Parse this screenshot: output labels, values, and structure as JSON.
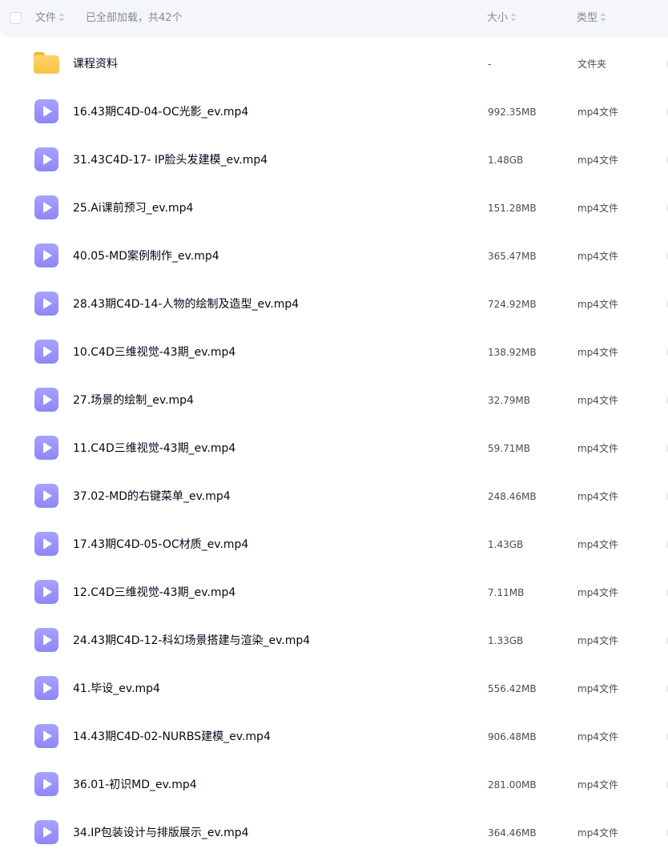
{
  "header": {
    "name_label": "文件",
    "status": "已全部加载，共42个",
    "size_label": "大小",
    "type_label": "类型"
  },
  "rows": [
    {
      "name": "课程资料",
      "size": "-",
      "type": "文件夹",
      "icon": "folder-icon"
    },
    {
      "name": "16.43期C4D-04-OC光影_ev.mp4",
      "size": "992.35MB",
      "type": "mp4文件",
      "icon": "video-file-icon"
    },
    {
      "name": "31.43C4D-17- IP脸头发建模_ev.mp4",
      "size": "1.48GB",
      "type": "mp4文件",
      "icon": "video-file-icon"
    },
    {
      "name": "25.Ai课前预习_ev.mp4",
      "size": "151.28MB",
      "type": "mp4文件",
      "icon": "video-file-icon"
    },
    {
      "name": "40.05-MD案例制作_ev.mp4",
      "size": "365.47MB",
      "type": "mp4文件",
      "icon": "video-file-icon"
    },
    {
      "name": "28.43期C4D-14-人物的绘制及造型_ev.mp4",
      "size": "724.92MB",
      "type": "mp4文件",
      "icon": "video-file-icon"
    },
    {
      "name": "10.C4D三维视觉-43期_ev.mp4",
      "size": "138.92MB",
      "type": "mp4文件",
      "icon": "video-file-icon"
    },
    {
      "name": "27.场景的绘制_ev.mp4",
      "size": "32.79MB",
      "type": "mp4文件",
      "icon": "video-file-icon"
    },
    {
      "name": "11.C4D三维视觉-43期_ev.mp4",
      "size": "59.71MB",
      "type": "mp4文件",
      "icon": "video-file-icon"
    },
    {
      "name": "37.02-MD的右键菜单_ev.mp4",
      "size": "248.46MB",
      "type": "mp4文件",
      "icon": "video-file-icon"
    },
    {
      "name": "17.43期C4D-05-OC材质_ev.mp4",
      "size": "1.43GB",
      "type": "mp4文件",
      "icon": "video-file-icon"
    },
    {
      "name": "12.C4D三维视觉-43期_ev.mp4",
      "size": "7.11MB",
      "type": "mp4文件",
      "icon": "video-file-icon"
    },
    {
      "name": "24.43期C4D-12-科幻场景搭建与渲染_ev.mp4",
      "size": "1.33GB",
      "type": "mp4文件",
      "icon": "video-file-icon"
    },
    {
      "name": "41.毕设_ev.mp4",
      "size": "556.42MB",
      "type": "mp4文件",
      "icon": "video-file-icon"
    },
    {
      "name": "14.43期C4D-02-NURBS建模_ev.mp4",
      "size": "906.48MB",
      "type": "mp4文件",
      "icon": "video-file-icon"
    },
    {
      "name": "36.01-初识MD_ev.mp4",
      "size": "281.00MB",
      "type": "mp4文件",
      "icon": "video-file-icon"
    },
    {
      "name": "34.IP包装设计与排版展示_ev.mp4",
      "size": "364.46MB",
      "type": "mp4文件",
      "icon": "video-file-icon"
    }
  ]
}
